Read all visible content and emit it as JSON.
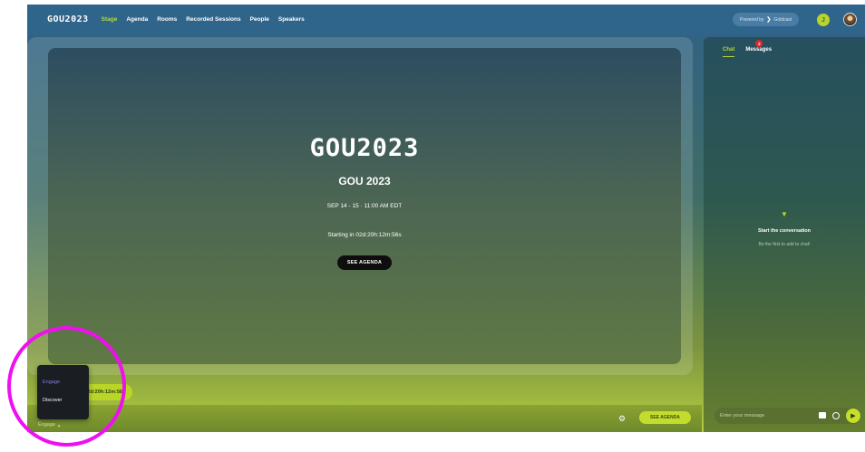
{
  "brand": {
    "name": "GOU2023"
  },
  "nav": {
    "items": [
      {
        "label": "Stage",
        "active": true
      },
      {
        "label": "Agenda",
        "active": false
      },
      {
        "label": "Rooms",
        "active": false
      },
      {
        "label": "Recorded Sessions",
        "active": false
      },
      {
        "label": "People",
        "active": false
      },
      {
        "label": "Speakers",
        "active": false
      }
    ]
  },
  "header": {
    "powered_by": "Powered by",
    "powered_by_brand": "Goldcast",
    "user_initial": "J"
  },
  "stage": {
    "logo_text": "GOU2023",
    "title": "GOU 2023",
    "date": "SEP 14 - 15 · 11:00 AM EDT",
    "countdown": "Starting in 02d:20h:12m:56s",
    "see_agenda_label": "SEE AGENDA"
  },
  "bottom": {
    "countdown_pill": "02d:20h:12m:56s",
    "engage_label": "Engage",
    "see_agenda_label": "SEE AGENDA"
  },
  "chat": {
    "tabs": [
      {
        "label": "Chat",
        "active": true
      },
      {
        "label": "Messages",
        "active": false,
        "badge": "2"
      }
    ],
    "empty_title": "Start the conversation",
    "empty_subtitle": "Be the first to add to chat!",
    "input_placeholder": "Enter your message"
  },
  "popup": {
    "items": [
      {
        "label": "Engage",
        "active": true
      },
      {
        "label": "Discover",
        "active": false
      }
    ]
  },
  "colors": {
    "accent": "#b9d628",
    "header_bg": "#2f648b",
    "highlight": "#f00ff0"
  }
}
